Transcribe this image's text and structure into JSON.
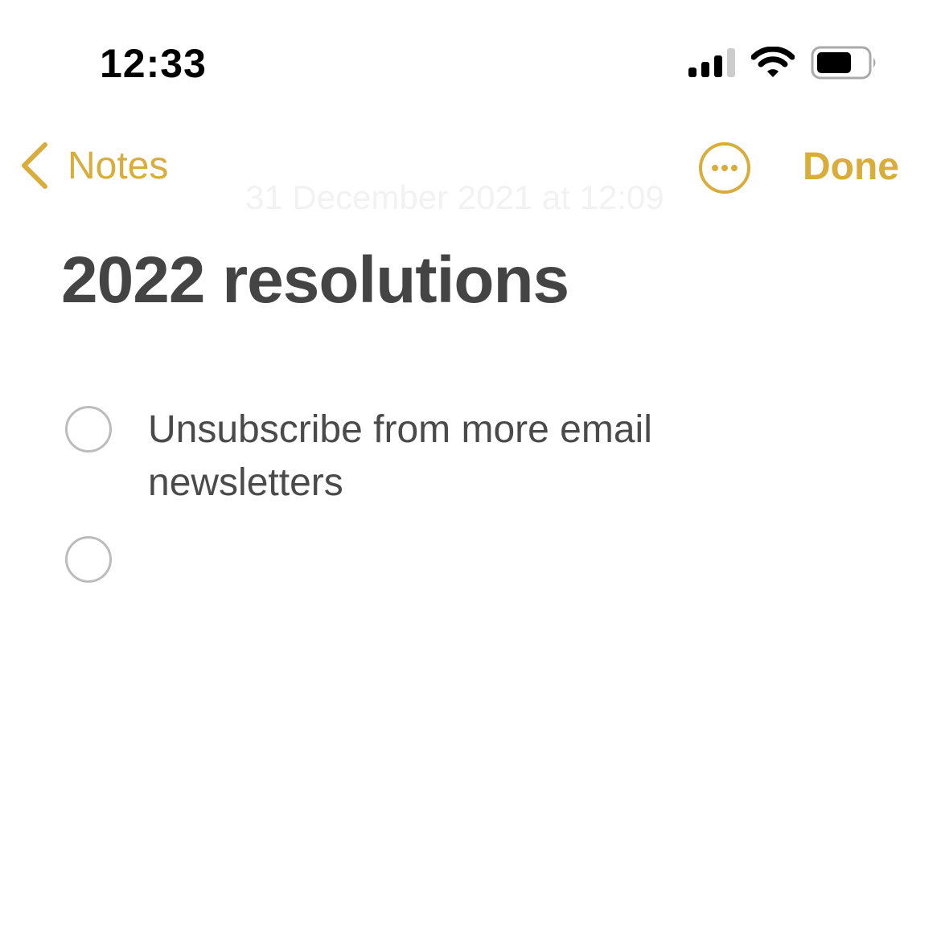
{
  "status_bar": {
    "time": "12:33",
    "signal_bars": 3,
    "signal_total": 4,
    "battery_level": 0.7
  },
  "nav": {
    "back_label": "Notes",
    "done_label": "Done",
    "date": "31 December 2021 at 12:09"
  },
  "note": {
    "title": "2022 resolutions",
    "checklist": [
      {
        "text": "Unsubscribe from more email newsletters",
        "checked": false
      },
      {
        "text": "",
        "checked": false
      }
    ]
  },
  "colors": {
    "accent": "#d9ad3c",
    "text": "#444444"
  }
}
